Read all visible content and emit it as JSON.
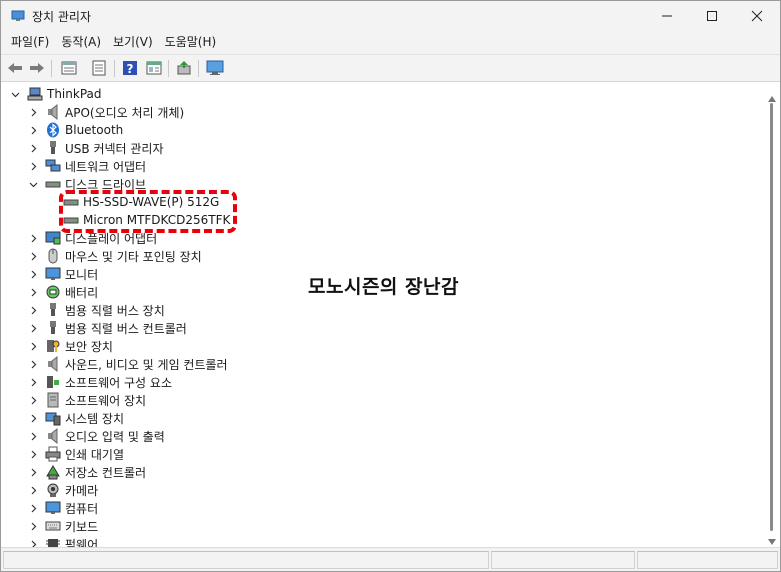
{
  "window": {
    "title": "장치 관리자"
  },
  "menu": [
    "파일(F)",
    "동작(A)",
    "보기(V)",
    "도움말(H)"
  ],
  "toolbar": {
    "buttons": [
      "back-icon",
      "forward-icon",
      "properties-pane-icon",
      "list-view-icon",
      "help-icon",
      "details-view-icon",
      "update-driver-icon",
      "scan-hardware-icon"
    ]
  },
  "tree": {
    "root": "ThinkPad",
    "categories": [
      "APO(오디오 처리 개체)",
      "Bluetooth",
      "USB 커넥터 관리자",
      "네트워크 어댑터",
      "디스크 드라이브",
      "디스플레이 어댑터",
      "마우스 및 기타 포인팅 장치",
      "모니터",
      "배터리",
      "범용 직렬 버스 장치",
      "범용 직렬 버스 컨트롤러",
      "보안 장치",
      "사운드, 비디오 및 게임 컨트롤러",
      "소프트웨어 구성 요소",
      "소프트웨어 장치",
      "시스템 장치",
      "오디오 입력 및 출력",
      "인쇄 대기열",
      "저장소 컨트롤러",
      "카메라",
      "컴퓨터",
      "키보드",
      "펌웨어"
    ],
    "disk_children": [
      "HS-SSD-WAVE(P) 512G",
      "Micron MTFDKCD256TFK"
    ],
    "expanded_category": "디스크 드라이브"
  },
  "watermark": "모노시즌의 장난감",
  "colors": {
    "highlight": "#e8000b",
    "tree_bg": "#ffffff",
    "chrome_bg": "#f3f3f3"
  }
}
